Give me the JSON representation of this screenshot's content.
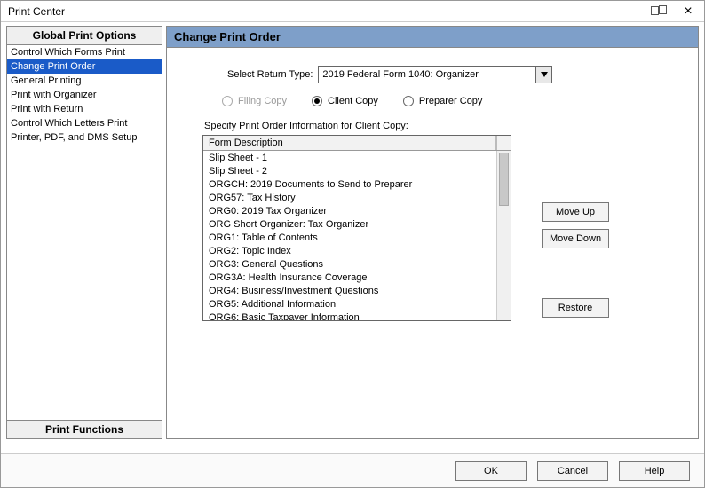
{
  "window": {
    "title": "Print Center",
    "close_label": "×"
  },
  "sidebar": {
    "header": "Global Print Options",
    "footer": "Print Functions",
    "items": [
      "Control Which Forms Print",
      "Change Print Order",
      "General Printing",
      "Print with Organizer",
      "Print with Return",
      "Control Which Letters Print",
      "Printer, PDF, and DMS Setup"
    ],
    "selected_index": 1
  },
  "panel": {
    "title": "Change Print Order",
    "select_label": "Select Return Type:",
    "select_value": "2019 Federal Form 1040: Organizer",
    "radios": {
      "filing": "Filing Copy",
      "client": "Client Copy",
      "preparer": "Preparer Copy",
      "checked": "client",
      "disabled": [
        "filing"
      ]
    },
    "specify_label": "Specify Print Order Information for Client Copy:",
    "list_header": "Form Description",
    "list_items": [
      "Slip Sheet - 1",
      "Slip Sheet - 2",
      "ORGCH: 2019 Documents to Send to Preparer",
      "ORG57: Tax History",
      "ORG0: 2019 Tax Organizer",
      "ORG Short Organizer: Tax Organizer",
      "ORG1: Table of Contents",
      "ORG2: Topic Index",
      "ORG3: General Questions",
      "ORG3A: Health Insurance Coverage",
      "ORG4: Business/Investment Questions",
      "ORG5: Additional Information",
      "ORG6: Basic Taxpayer Information"
    ],
    "buttons": {
      "move_up": "Move Up",
      "move_down": "Move Down",
      "restore": "Restore"
    }
  },
  "footer": {
    "ok": "OK",
    "cancel": "Cancel",
    "help": "Help"
  }
}
